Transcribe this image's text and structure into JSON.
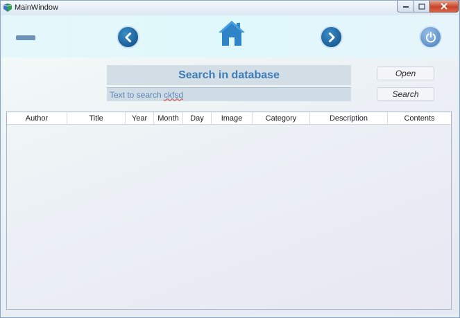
{
  "window": {
    "title": "MainWindow"
  },
  "toolbar": {
    "icons": [
      "menu-dash-icon",
      "back-arrow-icon",
      "home-icon",
      "forward-arrow-icon",
      "power-icon"
    ]
  },
  "search": {
    "title": "Search in database",
    "input_prefix": "Text to search ",
    "input_value": "ckfsd",
    "open_label": "Open",
    "search_label": "Search"
  },
  "grid": {
    "columns": [
      "Author",
      "Title",
      "Year",
      "Month",
      "Day",
      "Image",
      "Category",
      "Description",
      "Contents"
    ],
    "rows": []
  },
  "colors": {
    "accent": "#3d7cb7",
    "nav_button": "#1a5e97",
    "power_button": "#5d91c9"
  }
}
